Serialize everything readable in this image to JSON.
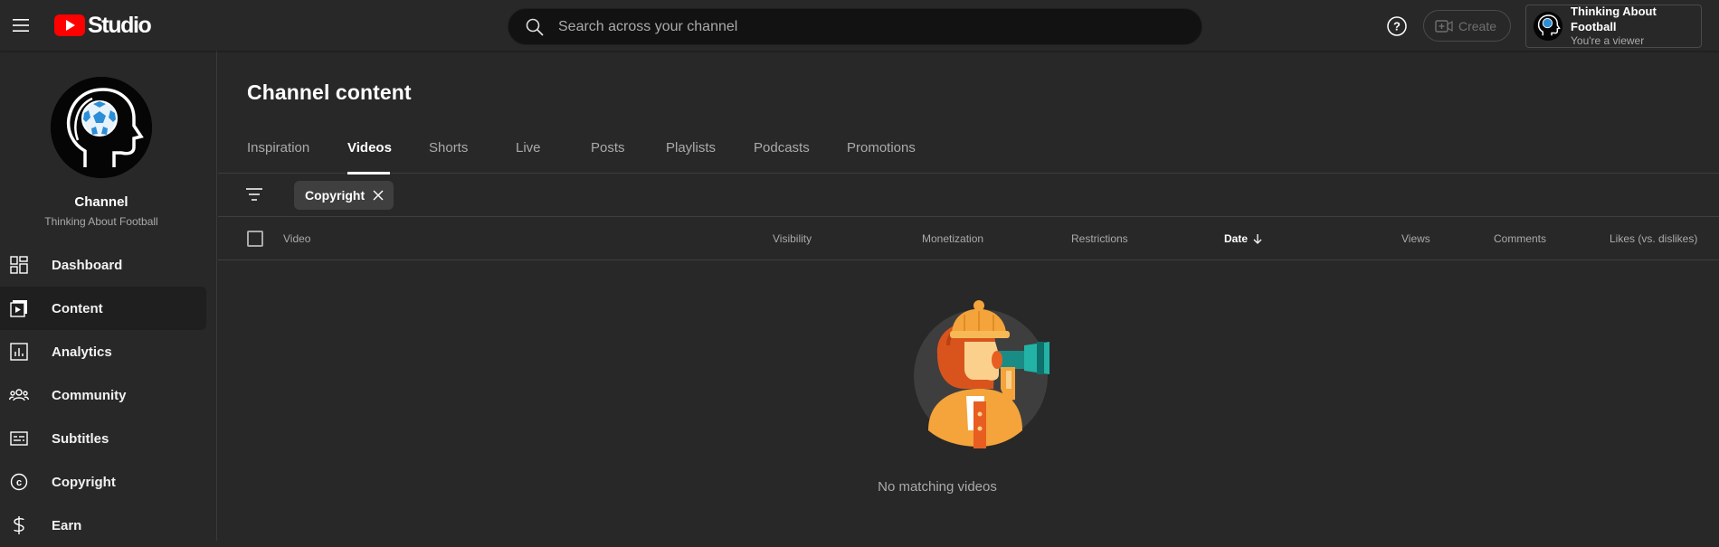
{
  "header": {
    "logo_text": "Studio",
    "search_placeholder": "Search across your channel",
    "create_label": "Create",
    "account": {
      "name": "Thinking About Football",
      "role": "You're a viewer"
    }
  },
  "sidebar": {
    "channel_title": "Channel",
    "channel_name": "Thinking About Football",
    "items": [
      {
        "label": "Dashboard",
        "icon": "dashboard-icon"
      },
      {
        "label": "Content",
        "icon": "content-icon",
        "active": true
      },
      {
        "label": "Analytics",
        "icon": "analytics-icon"
      },
      {
        "label": "Community",
        "icon": "community-icon"
      },
      {
        "label": "Subtitles",
        "icon": "subtitles-icon"
      },
      {
        "label": "Copyright",
        "icon": "copyright-icon"
      },
      {
        "label": "Earn",
        "icon": "dollar-icon"
      }
    ]
  },
  "main": {
    "title": "Channel content",
    "tabs": [
      {
        "label": "Inspiration"
      },
      {
        "label": "Videos",
        "active": true
      },
      {
        "label": "Shorts"
      },
      {
        "label": "Live"
      },
      {
        "label": "Posts"
      },
      {
        "label": "Playlists"
      },
      {
        "label": "Podcasts"
      },
      {
        "label": "Promotions"
      }
    ],
    "filter_chip": "Copyright",
    "columns": {
      "video": "Video",
      "visibility": "Visibility",
      "monetization": "Monetization",
      "restrictions": "Restrictions",
      "date": "Date",
      "views": "Views",
      "comments": "Comments",
      "likes": "Likes (vs. dislikes)"
    },
    "empty_message": "No matching videos"
  },
  "colors": {
    "background": "#282828",
    "brand_red": "#ff0000",
    "search_bg": "#121212",
    "active_nav_bg": "#1f1f1f",
    "muted_text": "#aaaaaa"
  }
}
